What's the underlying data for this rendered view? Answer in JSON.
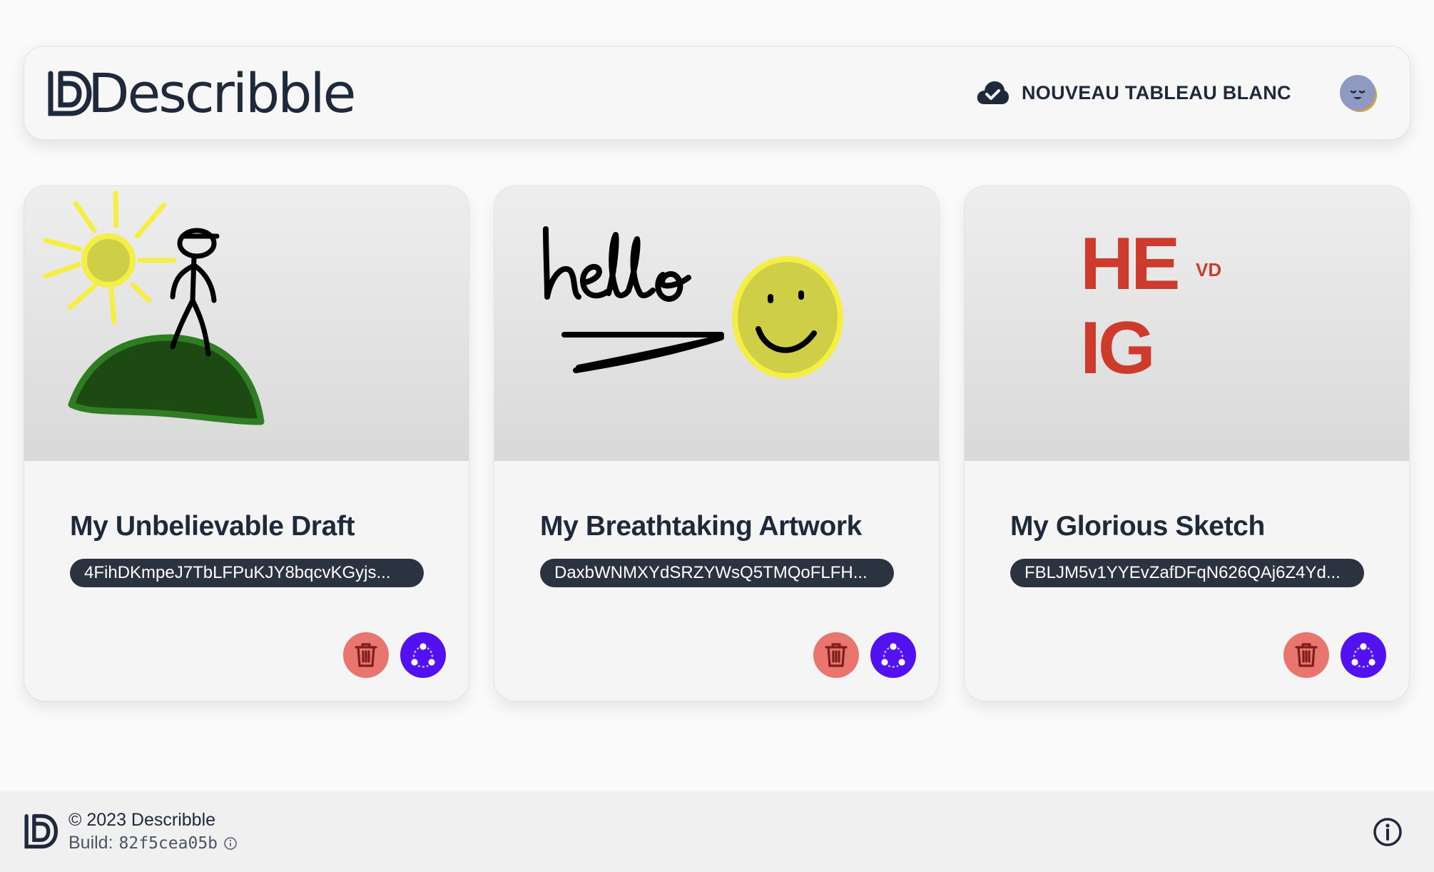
{
  "header": {
    "brand": "Describble",
    "new_board_label": "NOUVEAU TABLEAU BLANC",
    "new_board_icon": "cloud-check-icon",
    "avatar_icon": "sleepy-face-avatar"
  },
  "boards": [
    {
      "title": "My Unbelievable Draft",
      "id": "4FihDKmpeJ7TbLFPuKJY8bqcvKGyjs...",
      "thumbnail": "sun-hill-stickman-drawing"
    },
    {
      "title": "My Breathtaking Artwork",
      "id": "DaxbWNMXYdSRZYWsQ5TMQoFLFH...",
      "thumbnail": "hello-smiley-drawing"
    },
    {
      "title": "My Glorious Sketch",
      "id": "FBLJM5v1YYEvZafDFqN626QAj6Z4Yd...",
      "thumbnail": "heig-vd-logo-drawing"
    }
  ],
  "heig_logo": {
    "line1": "HE",
    "line2": "IG",
    "sup": "VD"
  },
  "actions": {
    "delete_icon": "trash-icon",
    "share_icon": "share-icon"
  },
  "footer": {
    "copyright": "© 2023 Describble",
    "build_label": "Build:",
    "build_hash": "82f5cea05b"
  },
  "colors": {
    "accent": "#5411f0",
    "danger": "#e8766f",
    "text": "#1e2a3b",
    "heig_red": "#cc3b2b"
  }
}
